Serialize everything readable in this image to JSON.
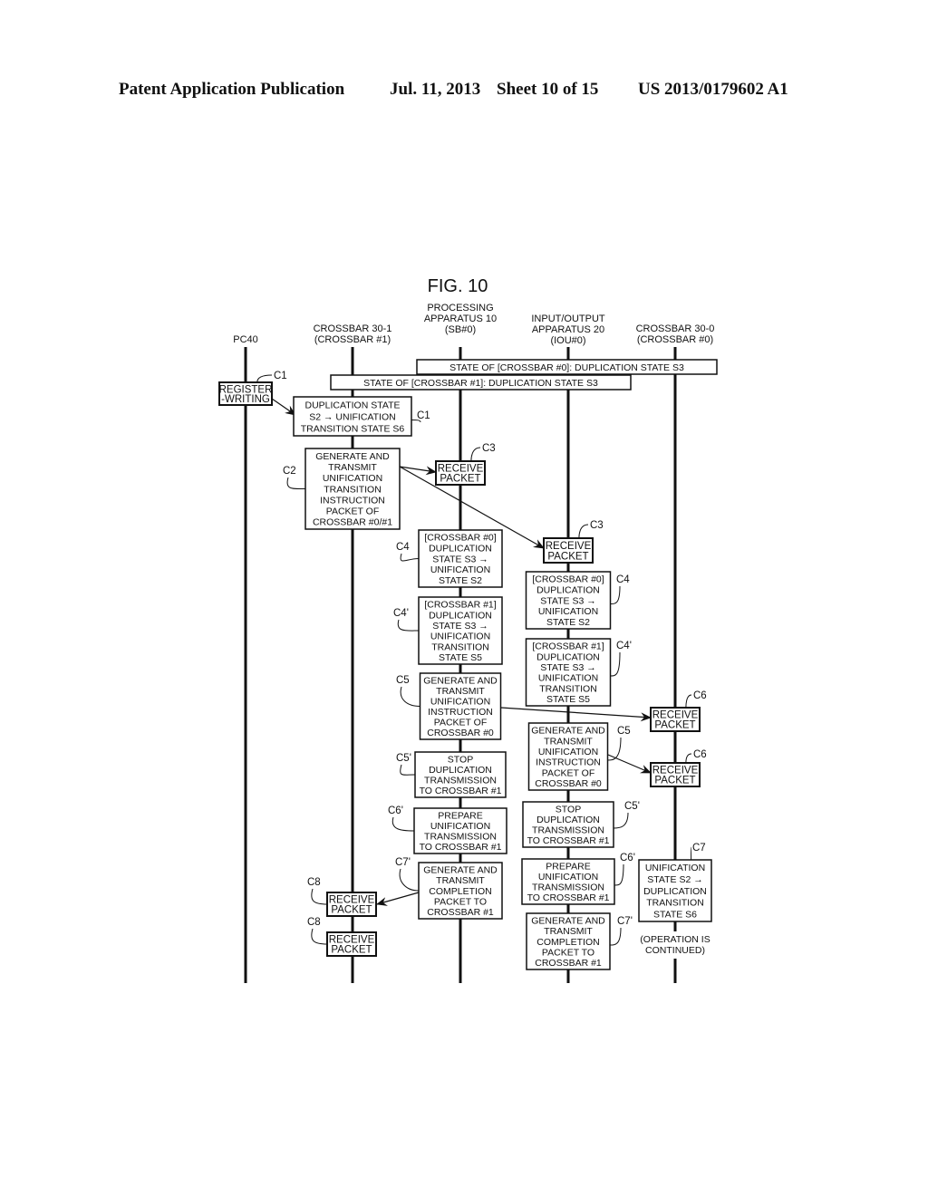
{
  "header": {
    "left": "Patent Application Publication",
    "date": "Jul. 11, 2013",
    "sheet": "Sheet 10 of 15",
    "number": "US 2013/0179602 A1"
  },
  "figure": {
    "title": "FIG. 10",
    "lifelines": [
      {
        "id": "pc",
        "label": [
          "PC40"
        ]
      },
      {
        "id": "xb1",
        "label": [
          "CROSSBAR 30-1",
          "(CROSSBAR #1)"
        ]
      },
      {
        "id": "sb",
        "label": [
          "PROCESSING",
          "APPARATUS 10",
          "(SB#0)"
        ]
      },
      {
        "id": "iou",
        "label": [
          "INPUT/OUTPUT",
          "APPARATUS 20",
          "(IOU#0)"
        ]
      },
      {
        "id": "xb0",
        "label": [
          "CROSSBAR 30-0",
          "(CROSSBAR #0)"
        ]
      }
    ],
    "state_bars": [
      {
        "id": "state-crossbar0",
        "text": "STATE OF [CROSSBAR #0]: DUPLICATION STATE S3"
      },
      {
        "id": "state-crossbar1",
        "text": "STATE OF [CROSSBAR #1]: DUPLICATION STATE S3"
      }
    ],
    "boxes": [
      {
        "id": "pc-register-writing",
        "step": "C1",
        "lines": [
          "REGISTER",
          "-WRITING"
        ]
      },
      {
        "id": "xb1-state-change",
        "step": "C1",
        "lines": [
          "DUPLICATION STATE",
          "S2 → UNIFICATION",
          "TRANSITION STATE S6"
        ]
      },
      {
        "id": "xb1-generate-transmit",
        "step": "C2",
        "lines": [
          "GENERATE AND",
          "TRANSMIT",
          "UNIFICATION",
          "TRANSITION",
          "INSTRUCTION",
          "PACKET OF",
          "CROSSBAR #0/#1"
        ]
      },
      {
        "id": "sb-receive-packet",
        "step": "C3",
        "lines": [
          "RECEIVE",
          "PACKET"
        ]
      },
      {
        "id": "iou-receive-packet",
        "step": "C3",
        "lines": [
          "RECEIVE",
          "PACKET"
        ]
      },
      {
        "id": "sb-crossbar0-state",
        "step": "C4",
        "lines": [
          "[CROSSBAR #0]",
          "DUPLICATION",
          "STATE S3 →",
          "UNIFICATION",
          "STATE S2"
        ]
      },
      {
        "id": "iou-crossbar0-state",
        "step": "C4",
        "lines": [
          "[CROSSBAR #0]",
          "DUPLICATION",
          "STATE S3 →",
          "UNIFICATION",
          "STATE S2"
        ]
      },
      {
        "id": "sb-crossbar1-state",
        "step": "C4'",
        "lines": [
          "[CROSSBAR #1]",
          "DUPLICATION",
          "STATE S3 →",
          "UNIFICATION",
          "TRANSITION",
          "STATE S5"
        ]
      },
      {
        "id": "iou-crossbar1-state",
        "step": "C4'",
        "lines": [
          "[CROSSBAR #1]",
          "DUPLICATION",
          "STATE S3 →",
          "UNIFICATION",
          "TRANSITION",
          "STATE S5"
        ]
      },
      {
        "id": "sb-generate-unification",
        "step": "C5",
        "lines": [
          "GENERATE AND",
          "TRANSMIT",
          "UNIFICATION",
          "INSTRUCTION",
          "PACKET OF",
          "CROSSBAR #0"
        ]
      },
      {
        "id": "iou-generate-unification",
        "step": "C5",
        "lines": [
          "GENERATE AND",
          "TRANSMIT",
          "UNIFICATION",
          "INSTRUCTION",
          "PACKET OF",
          "CROSSBAR #0"
        ]
      },
      {
        "id": "xb0-receive-packet-1",
        "step": "C6",
        "lines": [
          "RECEIVE",
          "PACKET"
        ]
      },
      {
        "id": "xb0-receive-packet-2",
        "step": "C6",
        "lines": [
          "RECEIVE",
          "PACKET"
        ]
      },
      {
        "id": "sb-stop-duplication",
        "step": "C5'",
        "lines": [
          "STOP",
          "DUPLICATION",
          "TRANSMISSION",
          "TO CROSSBAR #1"
        ]
      },
      {
        "id": "iou-stop-duplication",
        "step": "C5'",
        "lines": [
          "STOP",
          "DUPLICATION",
          "TRANSMISSION",
          "TO CROSSBAR #1"
        ]
      },
      {
        "id": "sb-prepare-unification",
        "step": "C6'",
        "lines": [
          "PREPARE",
          "UNIFICATION",
          "TRANSMISSION",
          "TO CROSSBAR #1"
        ]
      },
      {
        "id": "iou-prepare-unification",
        "step": "C6'",
        "lines": [
          "PREPARE",
          "UNIFICATION",
          "TRANSMISSION",
          "TO CROSSBAR #1"
        ]
      },
      {
        "id": "xb0-unification-state",
        "step": "C7",
        "lines": [
          "UNIFICATION",
          "STATE S2 →",
          "DUPLICATION",
          "TRANSITION",
          "STATE S6"
        ]
      },
      {
        "id": "sb-generate-completion",
        "step": "C7'",
        "lines": [
          "GENERATE AND",
          "TRANSMIT",
          "COMPLETION",
          "PACKET TO",
          "CROSSBAR #1"
        ]
      },
      {
        "id": "iou-generate-completion",
        "step": "C7'",
        "lines": [
          "GENERATE AND",
          "TRANSMIT",
          "COMPLETION",
          "PACKET TO",
          "CROSSBAR #1"
        ]
      },
      {
        "id": "xb1-receive-packet-1",
        "step": "C8",
        "lines": [
          "RECEIVE",
          "PACKET"
        ]
      },
      {
        "id": "xb1-receive-packet-2",
        "step": "C8",
        "lines": [
          "RECEIVE",
          "PACKET"
        ]
      }
    ],
    "note": [
      "(OPERATION IS",
      "CONTINUED)"
    ]
  }
}
